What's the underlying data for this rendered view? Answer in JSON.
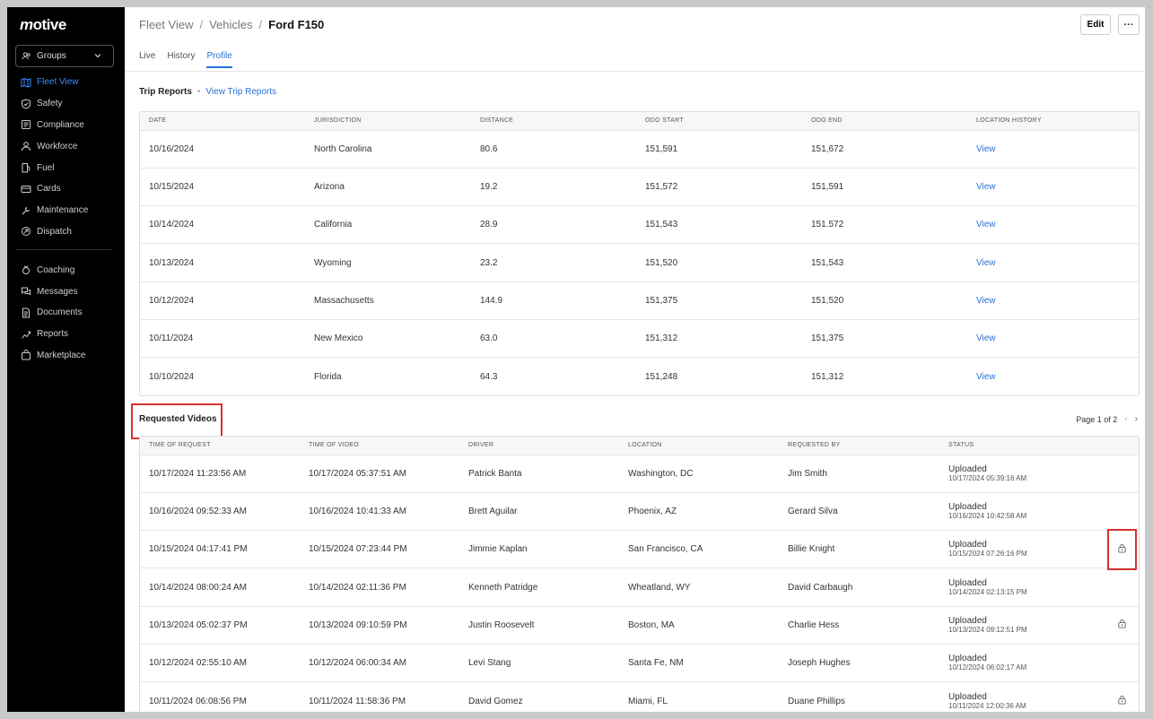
{
  "brand": {
    "logo": "motive"
  },
  "sidebar": {
    "groups_label": "Groups",
    "items": [
      {
        "label": "Fleet View",
        "icon": "map-icon",
        "active": true
      },
      {
        "label": "Safety",
        "icon": "shield-icon"
      },
      {
        "label": "Compliance",
        "icon": "compliance-icon"
      },
      {
        "label": "Workforce",
        "icon": "person-icon"
      },
      {
        "label": "Fuel",
        "icon": "fuel-icon"
      },
      {
        "label": "Cards",
        "icon": "card-icon"
      },
      {
        "label": "Maintenance",
        "icon": "wrench-icon"
      },
      {
        "label": "Dispatch",
        "icon": "dispatch-icon"
      }
    ],
    "items2": [
      {
        "label": "Coaching",
        "icon": "coaching-icon"
      },
      {
        "label": "Messages",
        "icon": "messages-icon"
      },
      {
        "label": "Documents",
        "icon": "document-icon"
      },
      {
        "label": "Reports",
        "icon": "reports-icon"
      },
      {
        "label": "Marketplace",
        "icon": "bag-icon"
      }
    ]
  },
  "header": {
    "breadcrumb": [
      "Fleet View",
      "Vehicles",
      "Ford F150"
    ],
    "tabs": [
      "Live",
      "History",
      "Profile"
    ],
    "active_tab": "Profile",
    "edit_label": "Edit",
    "more_label": "···"
  },
  "trip_reports": {
    "title": "Trip Reports",
    "link": "View Trip Reports",
    "columns": [
      "DATE",
      "JURISDICTION",
      "DISTANCE",
      "ODO START",
      "ODO END",
      "LOCATION HISTORY"
    ],
    "rows": [
      [
        "10/16/2024",
        "North Carolina",
        "80.6",
        "151,591",
        "151,672",
        "View"
      ],
      [
        "10/15/2024",
        "Arizona",
        "19.2",
        "151,572",
        "151,591",
        "View"
      ],
      [
        "10/14/2024",
        "California",
        "28.9",
        "151,543",
        "151.572",
        "View"
      ],
      [
        "10/13/2024",
        "Wyoming",
        "23.2",
        "151,520",
        "151,543",
        "View"
      ],
      [
        "10/12/2024",
        "Massachusetts",
        "144.9",
        "151,375",
        "151,520",
        "View"
      ],
      [
        "10/11/2024",
        "New Mexico",
        "63.0",
        "151,312",
        "151,375",
        "View"
      ],
      [
        "10/10/2024",
        "Florida",
        "64.3",
        "151,248",
        "151,312",
        "View"
      ]
    ]
  },
  "requested_videos": {
    "title": "Requested Videos",
    "pager": "Page 1 of 2",
    "columns": [
      "TIME OF REQUEST",
      "TIME OF VIDEO",
      "DRIVER",
      "LOCATION",
      "REQUESTED BY",
      "STATUS"
    ],
    "rows": [
      [
        "10/17/2024 11:23:56 AM",
        "10/17/2024 05:37:51 AM",
        "Patrick Banta",
        "Washington, DC",
        "Jim Smith",
        "Uploaded",
        "10/17/2024 05:39:16 AM",
        false
      ],
      [
        "10/16/2024 09:52:33 AM",
        "10/16/2024 10:41:33 AM",
        "Brett Aguilar",
        "Phoenix, AZ",
        "Gerard Silva",
        "Uploaded",
        "10/16/2024 10:42:58 AM",
        false
      ],
      [
        "10/15/2024 04:17:41 PM",
        "10/15/2024 07:23:44 PM",
        "Jimmie Kaplan",
        "San Francisco, CA",
        "Billie Knight",
        "Uploaded",
        "10/15/2024 07:26:16 PM",
        true
      ],
      [
        "10/14/2024 08:00:24 AM",
        "10/14/2024 02:11:36 PM",
        "Kenneth Patridge",
        "Wheatland, WY",
        "David Carbaugh",
        "Uploaded",
        "10/14/2024 02:13:15 PM",
        false
      ],
      [
        "10/13/2024 05:02:37 PM",
        "10/13/2024 09:10:59 PM",
        "Justin Roosevelt",
        "Boston, MA",
        "Charlie Hess",
        "Uploaded",
        "10/13/2024 09:12:51 PM",
        true
      ],
      [
        "10/12/2024 02:55:10 AM",
        "10/12/2024 06:00:34 AM",
        "Levi Stang",
        "Santa Fe, NM",
        "Joseph Hughes",
        "Uploaded",
        "10/12/2024 06:02:17 AM",
        false
      ],
      [
        "10/11/2024 06:08:56 PM",
        "10/11/2024 11:58:36 PM",
        "David Gomez",
        "Miami, FL",
        "Duane Phillips",
        "Uploaded",
        "10/11/2024 12:00:36 AM",
        true
      ]
    ]
  },
  "colors": {
    "accent": "#2a72d6",
    "sidebar_active": "#3d8bff",
    "highlight": "#d93030"
  }
}
